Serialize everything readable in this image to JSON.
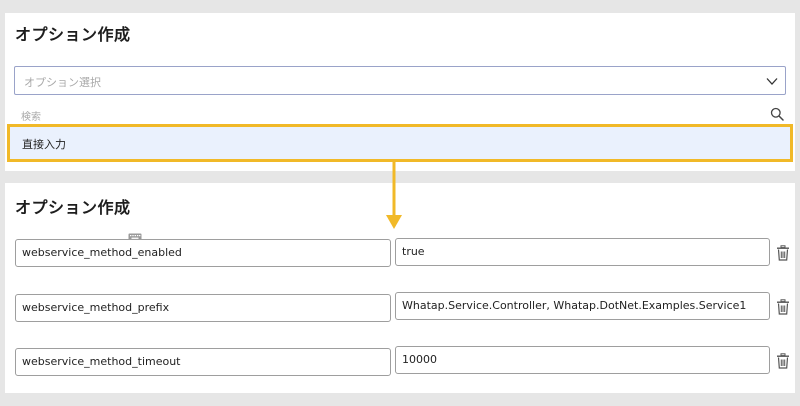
{
  "top": {
    "title": "オプション作成",
    "select_placeholder": "オプション選択",
    "search_placeholder": "検索",
    "option_direct_input": "直接入力"
  },
  "bottom": {
    "title": "オプション作成",
    "rows": [
      {
        "key": "webservice_method_enabled",
        "value": "true"
      },
      {
        "key": "webservice_method_prefix",
        "value": "Whatap.Service.Controller, Whatap.DotNet.Examples.Service1"
      },
      {
        "key": "webservice_method_timeout",
        "value": "10000"
      }
    ]
  },
  "colors": {
    "highlight_border": "#f1b928",
    "highlight_bg": "#eaf1fd",
    "arrow": "#f1b928"
  },
  "icons": [
    "chevron-down-icon",
    "search-icon",
    "keyboard-icon",
    "trash-icon",
    "arrow-down-icon"
  ]
}
